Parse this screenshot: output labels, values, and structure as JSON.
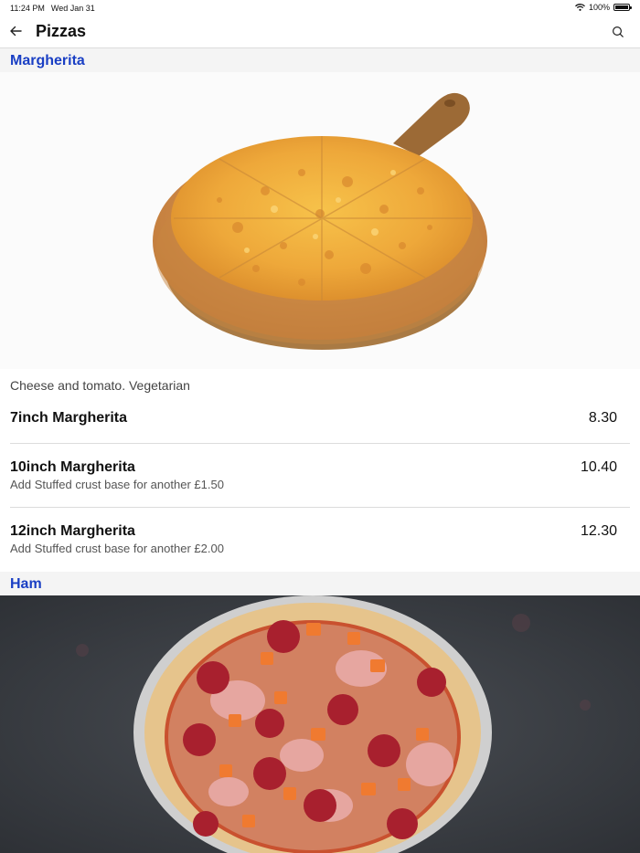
{
  "status_bar": {
    "time": "11:24 PM",
    "date": "Wed Jan 31",
    "battery": "100%",
    "battery_level": 1.0
  },
  "header": {
    "title": "Pizzas",
    "back_icon": "arrow-left-icon",
    "search_icon": "search-icon"
  },
  "sections": [
    {
      "title": "Margherita",
      "description": "Cheese and tomato. Vegetarian",
      "items": [
        {
          "name": "7inch Margherita",
          "note": "",
          "price": "8.30"
        },
        {
          "name": "10inch Margherita",
          "note": "Add Stuffed crust base for another £1.50",
          "price": "10.40"
        },
        {
          "name": "12inch Margherita",
          "note": "Add Stuffed crust base for another £2.00",
          "price": "12.30"
        }
      ]
    },
    {
      "title": "Ham"
    }
  ],
  "colors": {
    "section_title": "#1a3fc4",
    "section_bg": "#f4f4f4",
    "divider": "#dcdcdc"
  }
}
